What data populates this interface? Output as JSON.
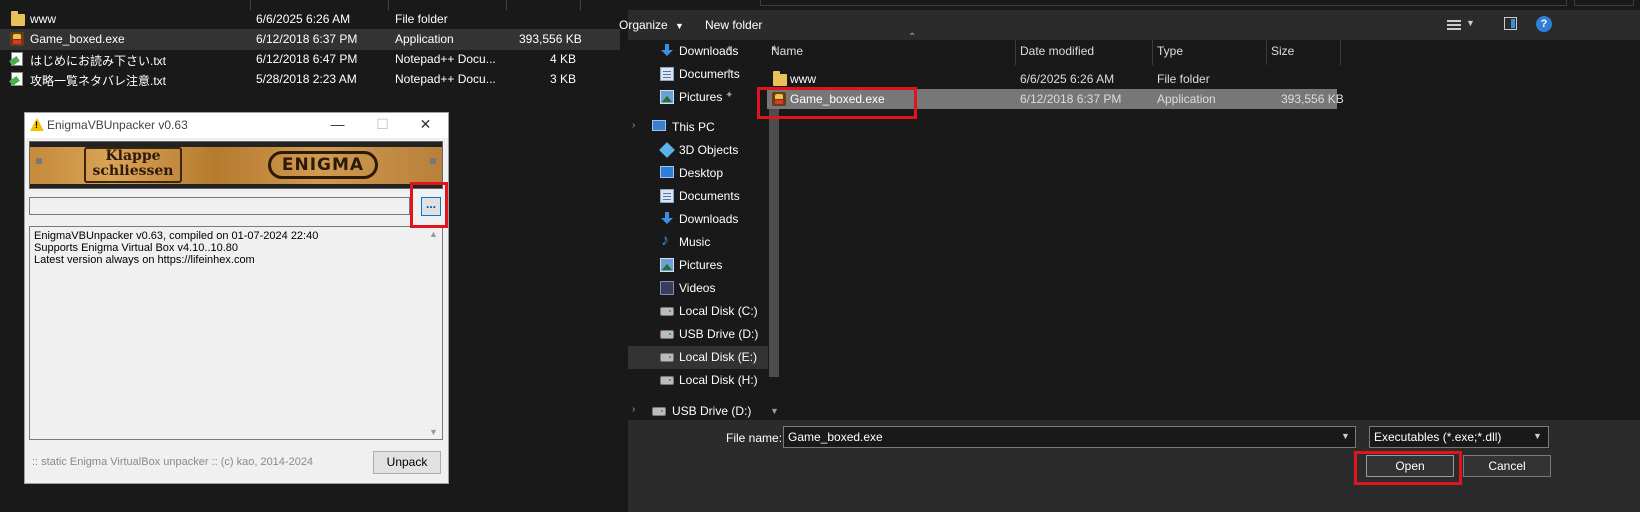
{
  "background_explorer": {
    "files": [
      {
        "name": "www",
        "date": "6/6/2025 6:26 AM",
        "type": "File folder",
        "size": "",
        "icon": "folder-icon"
      },
      {
        "name": "Game_boxed.exe",
        "date": "6/12/2018 6:37 PM",
        "type": "Application",
        "size": "393,556 KB",
        "icon": "app-icon"
      },
      {
        "name": "はじめにお読み下さい.txt",
        "date": "6/12/2018 6:47 PM",
        "type": "Notepad++ Docu...",
        "size": "4 KB",
        "icon": "text-file-icon"
      },
      {
        "name": "攻略一覧ネタバレ注意.txt",
        "date": "5/28/2018 2:23 AM",
        "type": "Notepad++ Docu...",
        "size": "3 KB",
        "icon": "text-file-icon"
      }
    ]
  },
  "unpacker": {
    "title": "EnigmaVBUnpacker v0.63",
    "banner": {
      "left_text_line1": "Klappe",
      "left_text_line2": "schliessen",
      "logo": "ENIGMA"
    },
    "path_value": "",
    "browse_label": "...",
    "log_lines": [
      "EnigmaVBUnpacker v0.63, compiled on 01-07-2024 22:40",
      "Supports Enigma Virtual Box v4.10..10.80",
      "Latest version always on https://lifeinhex.com"
    ],
    "footer": ":: static Enigma VirtualBox unpacker :: (c) kao, 2014-2024",
    "unpack_label": "Unpack",
    "window_controls": {
      "minimize": "—",
      "maximize": "☐",
      "close": "✕"
    }
  },
  "dialog": {
    "toolbar": {
      "organize": "Organize",
      "new_folder": "New folder"
    },
    "nav": {
      "quick_access": [
        {
          "label": "Downloads",
          "icon": "download-icon",
          "pinned": true
        },
        {
          "label": "Documents",
          "icon": "document-icon",
          "pinned": true
        },
        {
          "label": "Pictures",
          "icon": "pictures-icon",
          "pinned": true
        }
      ],
      "this_pc_label": "This PC",
      "this_pc": [
        {
          "label": "3D Objects",
          "icon": "3d-objects-icon"
        },
        {
          "label": "Desktop",
          "icon": "desktop-icon"
        },
        {
          "label": "Documents",
          "icon": "document-icon"
        },
        {
          "label": "Downloads",
          "icon": "download-icon"
        },
        {
          "label": "Music",
          "icon": "music-icon"
        },
        {
          "label": "Pictures",
          "icon": "pictures-icon"
        },
        {
          "label": "Videos",
          "icon": "videos-icon"
        },
        {
          "label": "Local Disk (C:)",
          "icon": "disk-icon"
        },
        {
          "label": "USB Drive (D:)",
          "icon": "disk-icon"
        },
        {
          "label": "Local Disk (E:)",
          "icon": "disk-icon",
          "selected": true
        },
        {
          "label": "Local Disk (H:)",
          "icon": "disk-icon"
        }
      ],
      "usb_drive_label": "USB Drive (D:)"
    },
    "columns": {
      "name": "Name",
      "date": "Date modified",
      "type": "Type",
      "size": "Size"
    },
    "files": [
      {
        "name": "www",
        "date": "6/6/2025 6:26 AM",
        "type": "File folder",
        "size": "",
        "icon": "folder-icon"
      },
      {
        "name": "Game_boxed.exe",
        "date": "6/12/2018 6:37 PM",
        "type": "Application",
        "size": "393,556 KB",
        "icon": "app-icon",
        "selected": true
      }
    ],
    "filename_label": "File name:",
    "filename_value": "Game_boxed.exe",
    "filter_value": "Executables (*.exe;*.dll)",
    "open_label": "Open",
    "cancel_label": "Cancel"
  },
  "colors": {
    "highlight": "#e0141e",
    "dark_bg": "#191919",
    "selected_row": "#777777"
  }
}
